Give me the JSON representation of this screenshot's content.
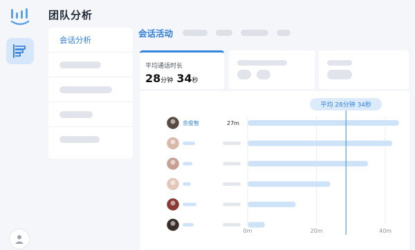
{
  "app": {
    "title": "团队分析"
  },
  "nav": {
    "active_label": "会话分析"
  },
  "tabs": {
    "active_label": "会话活动"
  },
  "metric": {
    "label": "平均通话时长",
    "minutes": "28",
    "minutes_unit": "分钟",
    "seconds": "34",
    "seconds_unit": "秒"
  },
  "colors": {
    "accent": "#2f7fd8",
    "bar": "#cfe3f8",
    "avg_line": "#5a9ce0"
  },
  "chart_data": {
    "type": "bar",
    "orientation": "horizontal",
    "unit": "minutes",
    "xlim": [
      0,
      45
    ],
    "x_ticks": [
      "0m",
      "20m",
      "40m"
    ],
    "x_tick_values": [
      0,
      20,
      40
    ],
    "average": {
      "label": "平均  28分钟 34秒",
      "value": 28.57
    },
    "rows": [
      {
        "name": "余俊智",
        "value_label": "27m",
        "value": 44
      },
      {
        "name": "",
        "value_label": "",
        "value": 42
      },
      {
        "name": "",
        "value_label": "",
        "value": 35
      },
      {
        "name": "",
        "value_label": "",
        "value": 24
      },
      {
        "name": "",
        "value_label": "",
        "value": 14
      },
      {
        "name": "",
        "value_label": "",
        "value": 5
      }
    ]
  },
  "icons": {
    "logo": "bar-logo-icon",
    "rail_active": "funnel-chart-icon",
    "user": "user-icon"
  }
}
